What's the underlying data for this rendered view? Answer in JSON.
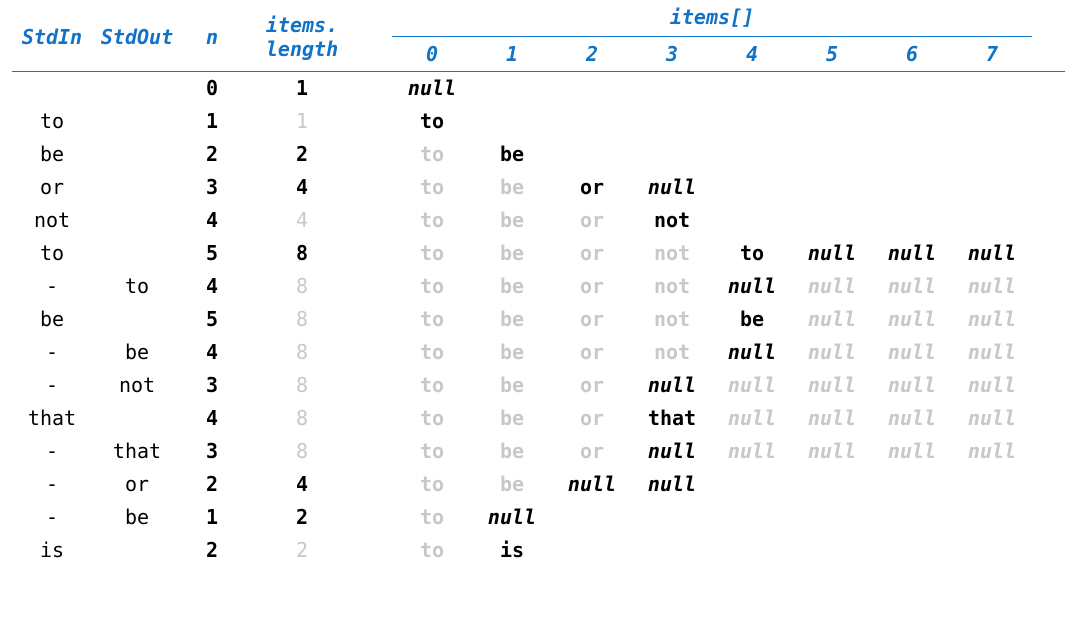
{
  "headers": {
    "stdin": "StdIn",
    "stdout": "StdOut",
    "n": "n",
    "items_length_top": "items.",
    "items_length_bot": "length",
    "items_array": "items[]"
  },
  "indices": [
    "0",
    "1",
    "2",
    "3",
    "4",
    "5",
    "6",
    "7"
  ],
  "rows": [
    {
      "stdin": "",
      "stdout": "",
      "n": "0",
      "len": {
        "v": "1",
        "changed": true
      },
      "cells": [
        {
          "t": "null",
          "k": "null",
          "changed": true
        }
      ]
    },
    {
      "stdin": "to",
      "stdout": "",
      "n": "1",
      "len": {
        "v": "1",
        "changed": false
      },
      "cells": [
        {
          "t": "to",
          "k": "word",
          "changed": true
        }
      ]
    },
    {
      "stdin": "be",
      "stdout": "",
      "n": "2",
      "len": {
        "v": "2",
        "changed": true
      },
      "cells": [
        {
          "t": "to",
          "k": "word",
          "changed": false
        },
        {
          "t": "be",
          "k": "word",
          "changed": true
        }
      ]
    },
    {
      "stdin": "or",
      "stdout": "",
      "n": "3",
      "len": {
        "v": "4",
        "changed": true
      },
      "cells": [
        {
          "t": "to",
          "k": "word",
          "changed": false
        },
        {
          "t": "be",
          "k": "word",
          "changed": false
        },
        {
          "t": "or",
          "k": "word",
          "changed": true
        },
        {
          "t": "null",
          "k": "null",
          "changed": true
        }
      ]
    },
    {
      "stdin": "not",
      "stdout": "",
      "n": "4",
      "len": {
        "v": "4",
        "changed": false
      },
      "cells": [
        {
          "t": "to",
          "k": "word",
          "changed": false
        },
        {
          "t": "be",
          "k": "word",
          "changed": false
        },
        {
          "t": "or",
          "k": "word",
          "changed": false
        },
        {
          "t": "not",
          "k": "word",
          "changed": true
        }
      ]
    },
    {
      "stdin": "to",
      "stdout": "",
      "n": "5",
      "len": {
        "v": "8",
        "changed": true
      },
      "cells": [
        {
          "t": "to",
          "k": "word",
          "changed": false
        },
        {
          "t": "be",
          "k": "word",
          "changed": false
        },
        {
          "t": "or",
          "k": "word",
          "changed": false
        },
        {
          "t": "not",
          "k": "word",
          "changed": false
        },
        {
          "t": "to",
          "k": "word",
          "changed": true
        },
        {
          "t": "null",
          "k": "null",
          "changed": true
        },
        {
          "t": "null",
          "k": "null",
          "changed": true
        },
        {
          "t": "null",
          "k": "null",
          "changed": true
        }
      ]
    },
    {
      "stdin": "-",
      "stdout": "to",
      "n": "4",
      "len": {
        "v": "8",
        "changed": false
      },
      "cells": [
        {
          "t": "to",
          "k": "word",
          "changed": false
        },
        {
          "t": "be",
          "k": "word",
          "changed": false
        },
        {
          "t": "or",
          "k": "word",
          "changed": false
        },
        {
          "t": "not",
          "k": "word",
          "changed": false
        },
        {
          "t": "null",
          "k": "null",
          "changed": true
        },
        {
          "t": "null",
          "k": "null",
          "changed": false
        },
        {
          "t": "null",
          "k": "null",
          "changed": false
        },
        {
          "t": "null",
          "k": "null",
          "changed": false
        }
      ]
    },
    {
      "stdin": "be",
      "stdout": "",
      "n": "5",
      "len": {
        "v": "8",
        "changed": false
      },
      "cells": [
        {
          "t": "to",
          "k": "word",
          "changed": false
        },
        {
          "t": "be",
          "k": "word",
          "changed": false
        },
        {
          "t": "or",
          "k": "word",
          "changed": false
        },
        {
          "t": "not",
          "k": "word",
          "changed": false
        },
        {
          "t": "be",
          "k": "word",
          "changed": true
        },
        {
          "t": "null",
          "k": "null",
          "changed": false
        },
        {
          "t": "null",
          "k": "null",
          "changed": false
        },
        {
          "t": "null",
          "k": "null",
          "changed": false
        }
      ]
    },
    {
      "stdin": "-",
      "stdout": "be",
      "n": "4",
      "len": {
        "v": "8",
        "changed": false
      },
      "cells": [
        {
          "t": "to",
          "k": "word",
          "changed": false
        },
        {
          "t": "be",
          "k": "word",
          "changed": false
        },
        {
          "t": "or",
          "k": "word",
          "changed": false
        },
        {
          "t": "not",
          "k": "word",
          "changed": false
        },
        {
          "t": "null",
          "k": "null",
          "changed": true
        },
        {
          "t": "null",
          "k": "null",
          "changed": false
        },
        {
          "t": "null",
          "k": "null",
          "changed": false
        },
        {
          "t": "null",
          "k": "null",
          "changed": false
        }
      ]
    },
    {
      "stdin": "-",
      "stdout": "not",
      "n": "3",
      "len": {
        "v": "8",
        "changed": false
      },
      "cells": [
        {
          "t": "to",
          "k": "word",
          "changed": false
        },
        {
          "t": "be",
          "k": "word",
          "changed": false
        },
        {
          "t": "or",
          "k": "word",
          "changed": false
        },
        {
          "t": "null",
          "k": "null",
          "changed": true
        },
        {
          "t": "null",
          "k": "null",
          "changed": false
        },
        {
          "t": "null",
          "k": "null",
          "changed": false
        },
        {
          "t": "null",
          "k": "null",
          "changed": false
        },
        {
          "t": "null",
          "k": "null",
          "changed": false
        }
      ]
    },
    {
      "stdin": "that",
      "stdout": "",
      "n": "4",
      "len": {
        "v": "8",
        "changed": false
      },
      "cells": [
        {
          "t": "to",
          "k": "word",
          "changed": false
        },
        {
          "t": "be",
          "k": "word",
          "changed": false
        },
        {
          "t": "or",
          "k": "word",
          "changed": false
        },
        {
          "t": "that",
          "k": "word",
          "changed": true
        },
        {
          "t": "null",
          "k": "null",
          "changed": false
        },
        {
          "t": "null",
          "k": "null",
          "changed": false
        },
        {
          "t": "null",
          "k": "null",
          "changed": false
        },
        {
          "t": "null",
          "k": "null",
          "changed": false
        }
      ]
    },
    {
      "stdin": "-",
      "stdout": "that",
      "n": "3",
      "len": {
        "v": "8",
        "changed": false
      },
      "cells": [
        {
          "t": "to",
          "k": "word",
          "changed": false
        },
        {
          "t": "be",
          "k": "word",
          "changed": false
        },
        {
          "t": "or",
          "k": "word",
          "changed": false
        },
        {
          "t": "null",
          "k": "null",
          "changed": true
        },
        {
          "t": "null",
          "k": "null",
          "changed": false
        },
        {
          "t": "null",
          "k": "null",
          "changed": false
        },
        {
          "t": "null",
          "k": "null",
          "changed": false
        },
        {
          "t": "null",
          "k": "null",
          "changed": false
        }
      ]
    },
    {
      "stdin": "-",
      "stdout": "or",
      "n": "2",
      "len": {
        "v": "4",
        "changed": true
      },
      "cells": [
        {
          "t": "to",
          "k": "word",
          "changed": false
        },
        {
          "t": "be",
          "k": "word",
          "changed": false
        },
        {
          "t": "null",
          "k": "null",
          "changed": true
        },
        {
          "t": "null",
          "k": "null",
          "changed": true
        }
      ]
    },
    {
      "stdin": "-",
      "stdout": "be",
      "n": "1",
      "len": {
        "v": "2",
        "changed": true
      },
      "cells": [
        {
          "t": "to",
          "k": "word",
          "changed": false
        },
        {
          "t": "null",
          "k": "null",
          "changed": true
        }
      ]
    },
    {
      "stdin": "is",
      "stdout": "",
      "n": "2",
      "len": {
        "v": "2",
        "changed": false
      },
      "cells": [
        {
          "t": "to",
          "k": "word",
          "changed": false
        },
        {
          "t": "is",
          "k": "word",
          "changed": true
        }
      ]
    }
  ]
}
